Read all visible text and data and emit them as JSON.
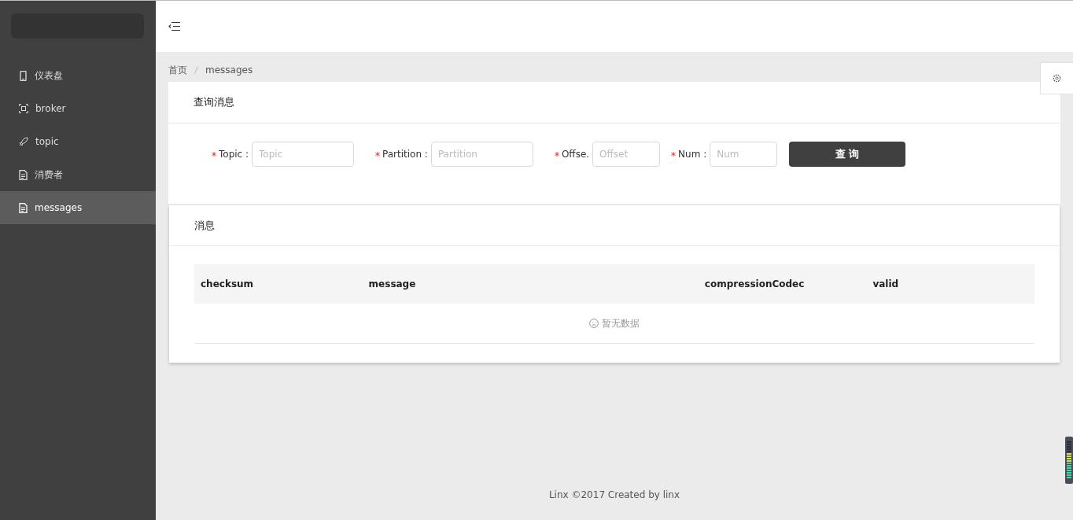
{
  "sidebar": {
    "items": [
      {
        "label": "仪表盘",
        "selected": false
      },
      {
        "label": "broker",
        "selected": false
      },
      {
        "label": "topic",
        "selected": false
      },
      {
        "label": "消费者",
        "selected": false
      },
      {
        "label": "messages",
        "selected": true
      }
    ]
  },
  "breadcrumb": [
    "首页",
    "messages"
  ],
  "query_card": {
    "title": "查询消息",
    "fields": [
      {
        "label": "Topic :",
        "placeholder": "Topic",
        "required": true
      },
      {
        "label": "Partition :",
        "placeholder": "Partition",
        "required": true
      },
      {
        "label": "Offse.",
        "placeholder": "Offset",
        "required": true
      },
      {
        "label": "Num :",
        "placeholder": "Num",
        "required": true
      }
    ],
    "button": "查 询"
  },
  "messages_card": {
    "title": "消息",
    "table": {
      "columns": [
        "checksum",
        "message",
        "compressionCodec",
        "valid"
      ],
      "empty_text": "暂无数据"
    }
  },
  "footer": "Linx ©2017 Created by linx"
}
